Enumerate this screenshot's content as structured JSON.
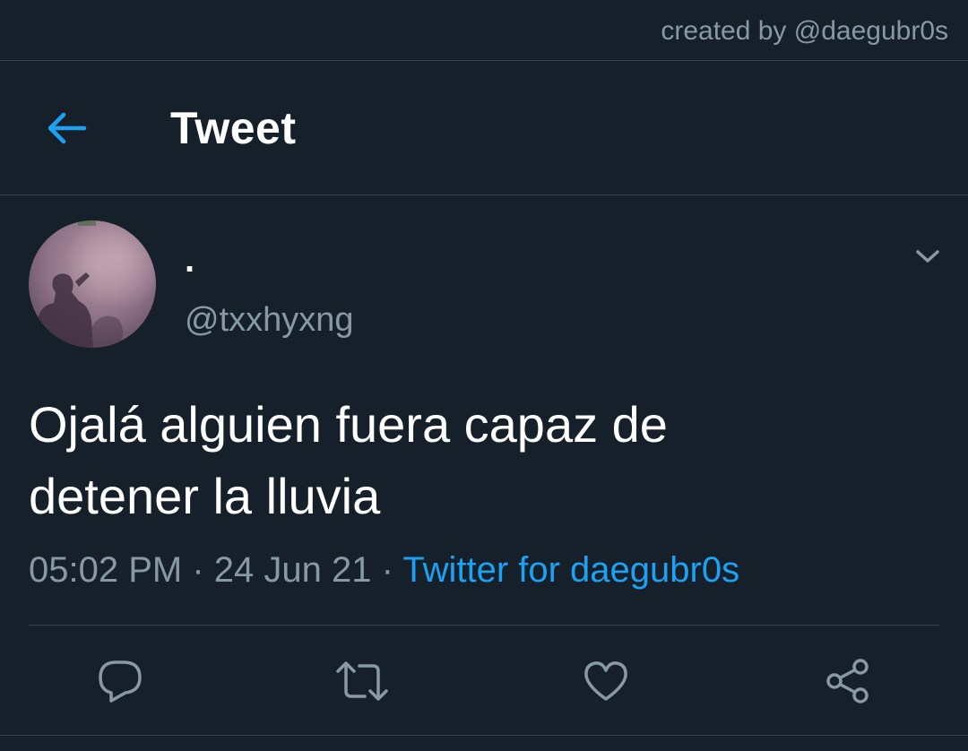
{
  "credit": "created by @daegubr0s",
  "header": {
    "back_icon": "arrow-left-icon",
    "title": "Tweet"
  },
  "tweet": {
    "author": {
      "display_name": ".",
      "handle": "@txxhyxng",
      "avatar": "shadow-selfie-avatar"
    },
    "menu_icon": "chevron-down-icon",
    "text_line1": "Ojalá alguien fuera capaz de",
    "text_line2": "detener la lluvia",
    "time": "05:02 PM",
    "separator": "·",
    "date": "24 Jun 21",
    "source": "Twitter for daegubr0s"
  },
  "actions": [
    {
      "icon": "reply-icon"
    },
    {
      "icon": "retweet-icon"
    },
    {
      "icon": "like-icon"
    },
    {
      "icon": "share-icon"
    }
  ],
  "colors": {
    "background": "#15202b",
    "border": "#38444d",
    "secondary_text": "#8899a6",
    "accent": "#1da1f2",
    "primary_text": "#ffffff"
  }
}
